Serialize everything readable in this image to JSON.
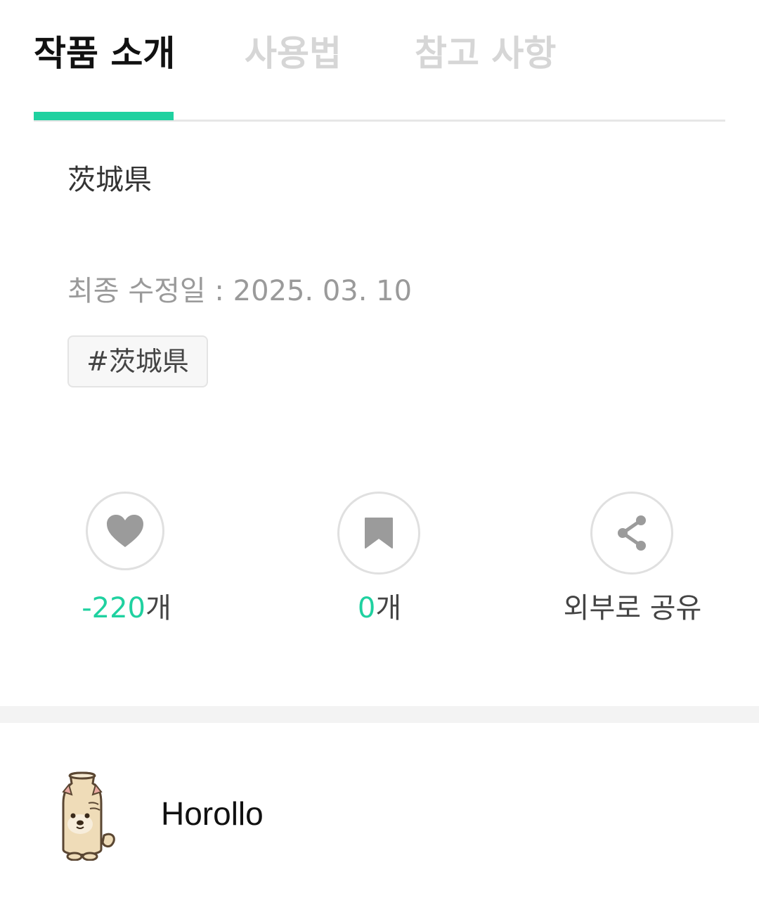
{
  "tabs": [
    {
      "label": "작품 소개",
      "active": true
    },
    {
      "label": "사용법",
      "active": false
    },
    {
      "label": "참고 사항",
      "active": false
    }
  ],
  "colors": {
    "accent": "#1fd1a0",
    "tab_inactive": "#d6d6d6",
    "text_dark": "#111111",
    "text_muted": "#9a9a9a",
    "icon_gray": "#9b9b9b"
  },
  "work": {
    "title": "茨城県",
    "updated_text": "최종 수정일 : 2025. 03. 10",
    "tags": [
      "#茨城県"
    ]
  },
  "actions": {
    "like": {
      "icon": "heart-icon",
      "count": "-220",
      "unit": "개"
    },
    "bookmark": {
      "icon": "bookmark-icon",
      "count": "0",
      "unit": "개"
    },
    "share": {
      "icon": "share-icon",
      "label": "외부로 공유"
    }
  },
  "author": {
    "avatar_icon": "bottle-dog-mascot",
    "name": "Horollo"
  }
}
